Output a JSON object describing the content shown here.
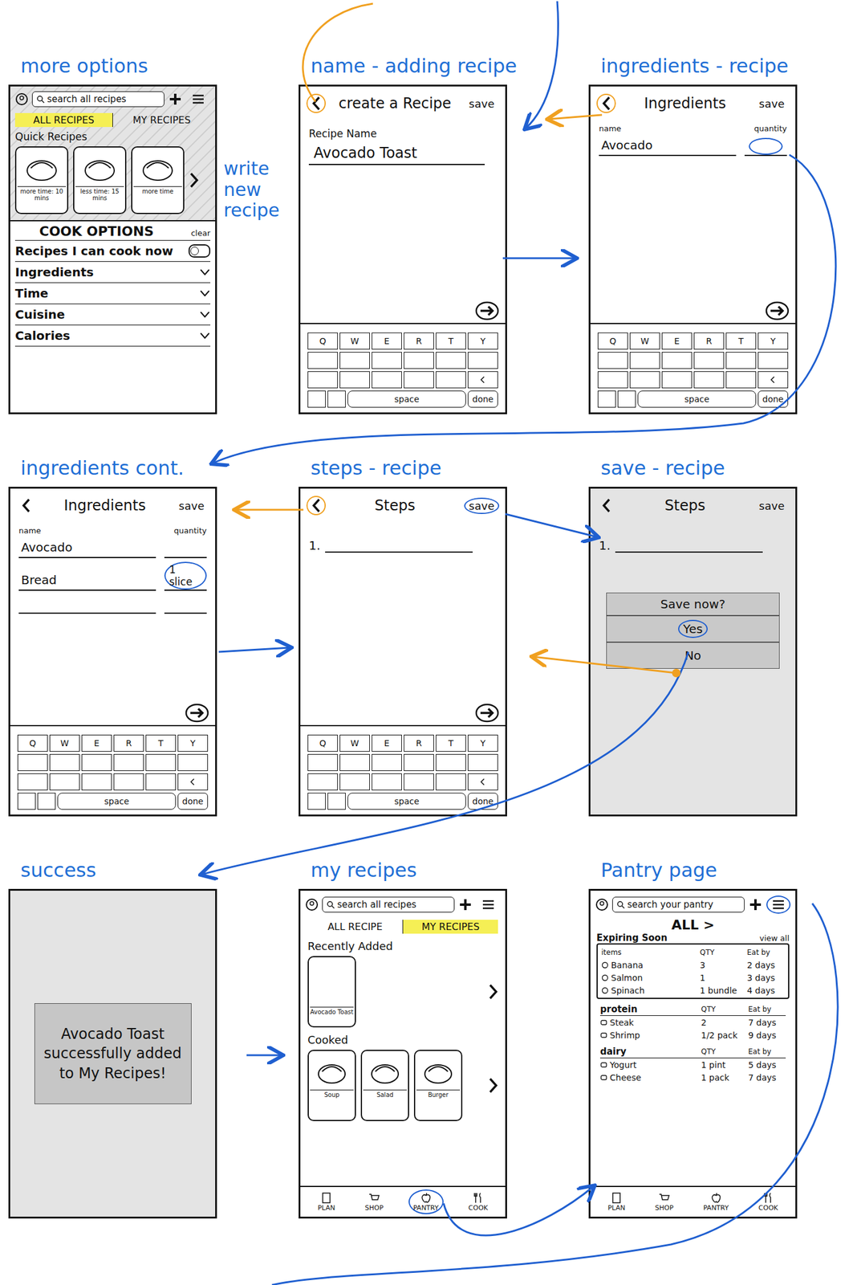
{
  "annotations": [
    {
      "text": "write new recipe"
    }
  ],
  "keyboard": {
    "keys": [
      "Q",
      "W",
      "E",
      "R",
      "T",
      "Y"
    ],
    "space": "space",
    "done": "done"
  },
  "screens": [
    {
      "label": "more options",
      "kind": "browse",
      "shaded": true,
      "search": "search all recipes",
      "menu": {
        "circled": false
      },
      "tabs": [
        {
          "label": "ALL RECIPES",
          "selected": true
        },
        {
          "label": "MY RECIPES",
          "selected": false
        }
      ],
      "section": "Quick Recipes",
      "cards": [
        {
          "caption": "more time: 10 mins"
        },
        {
          "caption": "less time: 15 mins"
        },
        {
          "caption": "more time"
        }
      ],
      "filters": {
        "title": "COOK OPTIONS",
        "clear": "clear",
        "rows": [
          {
            "label": "Recipes I can cook now",
            "kind": "toggle",
            "on": false
          },
          {
            "label": "Ingredients",
            "kind": "dropdown",
            "expanded": false
          },
          {
            "label": "Time",
            "kind": "dropdown",
            "expanded": false
          },
          {
            "label": "Cuisine",
            "kind": "dropdown",
            "expanded": false
          },
          {
            "label": "Calories",
            "kind": "dropdown",
            "expanded": false
          }
        ]
      }
    },
    {
      "label": "name - adding recipe",
      "kind": "form",
      "shaded": false,
      "keyboard": true,
      "back": {
        "circled": true,
        "color": "#f0a020"
      },
      "title": "create a Recipe",
      "save": {
        "label": "save",
        "circled": false
      },
      "field": {
        "label": "Recipe Name",
        "value": "Avocado Toast"
      }
    },
    {
      "label": "ingredients - recipe",
      "kind": "ingredients",
      "shaded": false,
      "keyboard": true,
      "back": {
        "circled": true,
        "color": "#f0a020"
      },
      "title": "Ingredients",
      "save": {
        "label": "save",
        "circled": false
      },
      "columns": {
        "name": "name",
        "quantity": "quantity"
      },
      "rows": [
        {
          "name": "Avocado",
          "quantity": "",
          "circled": true,
          "color": "#1f5fd0"
        }
      ]
    },
    {
      "label": "ingredients cont.",
      "kind": "ingredients",
      "shaded": false,
      "keyboard": true,
      "back": {
        "circled": false
      },
      "title": "Ingredients",
      "save": {
        "label": "save",
        "circled": false
      },
      "columns": {
        "name": "name",
        "quantity": "quantity"
      },
      "rows": [
        {
          "name": "Avocado",
          "quantity": "",
          "circled": false
        },
        {
          "name": "Bread",
          "quantity": "1 slice",
          "circled": true,
          "color": "#1f5fd0"
        },
        {
          "name": "",
          "quantity": "",
          "circled": false
        }
      ]
    },
    {
      "label": "steps - recipe",
      "kind": "steps",
      "shaded": false,
      "keyboard": true,
      "back": {
        "circled": true,
        "color": "#f0a020"
      },
      "title": "Steps",
      "save": {
        "label": "save",
        "circled": true,
        "color": "#1f5fd0"
      },
      "steps": [
        {
          "number": "1.",
          "text": ""
        }
      ]
    },
    {
      "label": "save - recipe",
      "kind": "steps",
      "shaded": true,
      "keyboard": false,
      "back": {
        "circled": false
      },
      "title": "Steps",
      "save": {
        "label": "save",
        "circled": false
      },
      "steps": [
        {
          "number": "1.",
          "text": ""
        }
      ],
      "dialog": {
        "question": "Save now?",
        "options": [
          {
            "label": "Yes",
            "circled": true,
            "color": "#1f5fd0"
          },
          {
            "label": "No",
            "circled": false
          }
        ]
      }
    },
    {
      "label": "success",
      "kind": "message",
      "shaded": true,
      "message": "Avocado Toast successfully added to My Recipes!"
    },
    {
      "label": "my recipes",
      "kind": "my-recipes",
      "shaded": false,
      "search": "search all recipes",
      "menu": {
        "circled": false
      },
      "tabs": [
        {
          "label": "ALL RECIPE",
          "selected": false
        },
        {
          "label": "MY RECIPES",
          "selected": true
        }
      ],
      "sections": [
        {
          "title": "Recently Added",
          "cards": [
            {
              "caption": "Avocado Toast"
            }
          ]
        },
        {
          "title": "Cooked",
          "cards": [
            {
              "caption": "Soup"
            },
            {
              "caption": "Salad"
            },
            {
              "caption": "Burger"
            }
          ]
        }
      ],
      "nav": [
        {
          "label": "PLAN",
          "circled": false
        },
        {
          "label": "SHOP",
          "circled": false
        },
        {
          "label": "PANTRY",
          "circled": true,
          "color": "#1f5fd0"
        },
        {
          "label": "COOK",
          "circled": false
        }
      ]
    },
    {
      "label": "Pantry page",
      "kind": "pantry",
      "shaded": false,
      "search": "search your pantry",
      "menu": {
        "circled": true,
        "color": "#1f5fd0"
      },
      "filter": "ALL >",
      "view_all": "view all",
      "expiring": {
        "title": "Expiring Soon",
        "columns": [
          "items",
          "QTY",
          "Eat by"
        ],
        "items": [
          {
            "name": "Banana",
            "qty": "3",
            "eat_by": "2 days"
          },
          {
            "name": "Salmon",
            "qty": "1",
            "eat_by": "3 days"
          },
          {
            "name": "Spinach",
            "qty": "1 bundle",
            "eat_by": "4 days"
          }
        ]
      },
      "sections": [
        {
          "title": "protein",
          "columns": [
            "QTY",
            "Eat by"
          ],
          "items": [
            {
              "name": "Steak",
              "qty": "2",
              "eat_by": "7 days"
            },
            {
              "name": "Shrimp",
              "qty": "1/2 pack",
              "eat_by": "9 days"
            }
          ]
        },
        {
          "title": "dairy",
          "columns": [
            "QTY",
            "Eat by"
          ],
          "items": [
            {
              "name": "Yogurt",
              "qty": "1 pint",
              "eat_by": "5 days"
            },
            {
              "name": "Cheese",
              "qty": "1 pack",
              "eat_by": "7 days"
            }
          ]
        }
      ],
      "nav": [
        {
          "label": "PLAN",
          "circled": false
        },
        {
          "label": "SHOP",
          "circled": false
        },
        {
          "label": "PANTRY",
          "circled": false
        },
        {
          "label": "COOK",
          "circled": false
        }
      ]
    }
  ]
}
